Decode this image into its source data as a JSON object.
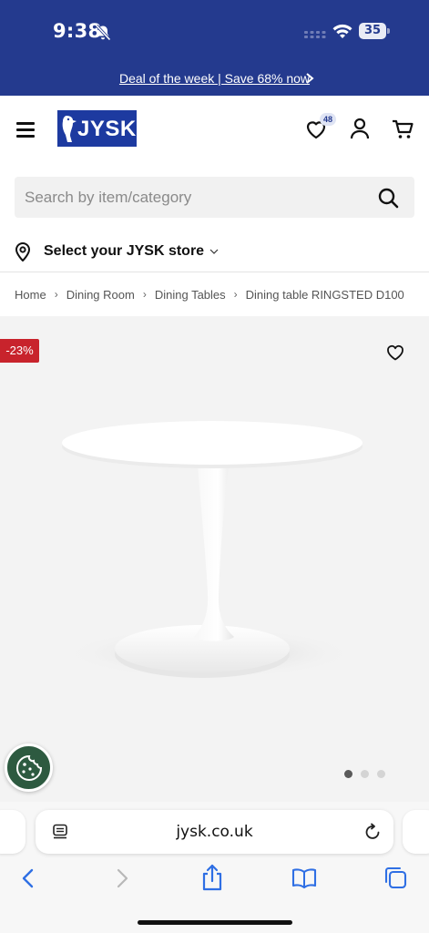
{
  "status_bar": {
    "time": "9:38",
    "battery": "35",
    "icons": [
      "bell-slash-icon",
      "signal-icon",
      "wifi-icon",
      "battery-icon"
    ]
  },
  "promo": {
    "text": "Deal of the week | Save 68% now",
    "icon": "chevron-right-icon"
  },
  "header": {
    "logo_text": "JYSK",
    "wishlist_count": "48",
    "icons": [
      "menu-icon",
      "heart-icon",
      "account-icon",
      "cart-icon"
    ]
  },
  "search": {
    "placeholder": "Search by item/category",
    "icon": "search-icon"
  },
  "store": {
    "label": "Select your JYSK store",
    "icon": "location-pin-icon"
  },
  "breadcrumb": {
    "items": [
      "Home",
      "Dining Room",
      "Dining Tables",
      "Dining table RINGSTED D100"
    ],
    "separator": "›"
  },
  "product": {
    "discount": "-23%",
    "image_index": 1,
    "image_count": 3
  },
  "browser": {
    "url": "jysk.co.uk",
    "icons": [
      "reader-icon",
      "reload-icon",
      "back-icon",
      "forward-icon",
      "share-icon",
      "bookmarks-icon",
      "tabs-icon"
    ]
  },
  "colors": {
    "brand_blue": "#243a8e",
    "sale_red": "#c8232c",
    "cookie_green": "#2d5a40"
  }
}
